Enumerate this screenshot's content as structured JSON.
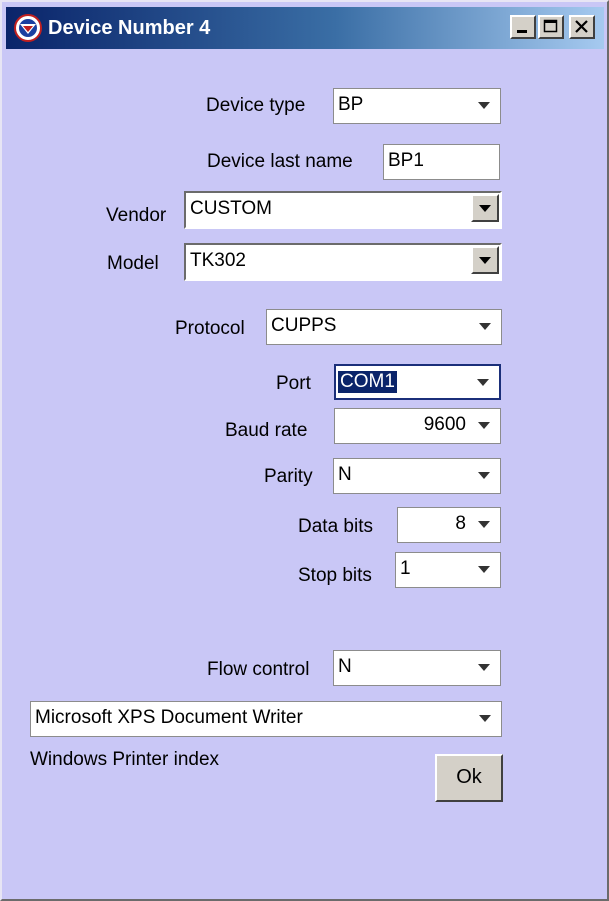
{
  "window": {
    "title": "Device Number 4"
  },
  "form": {
    "device_type": {
      "label": "Device type",
      "value": "BP"
    },
    "device_last_name": {
      "label": "Device last name",
      "value": "BP1"
    },
    "vendor": {
      "label": "Vendor",
      "value": "CUSTOM"
    },
    "model": {
      "label": "Model",
      "value": "TK302"
    },
    "protocol": {
      "label": "Protocol",
      "value": "CUPPS"
    },
    "port": {
      "label": "Port",
      "value": "COM1"
    },
    "baud_rate": {
      "label": "Baud rate",
      "value": "9600"
    },
    "parity": {
      "label": "Parity",
      "value": "N"
    },
    "data_bits": {
      "label": "Data bits",
      "value": "8"
    },
    "stop_bits": {
      "label": "Stop bits",
      "value": "1"
    },
    "flow_control": {
      "label": "Flow control",
      "value": "N"
    },
    "printer": {
      "value": "Microsoft XPS Document Writer",
      "label": "Windows Printer index"
    }
  },
  "buttons": {
    "ok_label": "Ok"
  },
  "colors": {
    "window_background": "#c9c7f6",
    "titlebar_start": "#0a246a",
    "titlebar_end": "#a6caf0",
    "selection": "#0a246a"
  },
  "icons": {
    "app_icon": "device-app-icon",
    "minimize": "minimize-icon",
    "maximize": "maximize-icon",
    "close": "close-icon",
    "dropdown": "chevron-down-icon"
  }
}
